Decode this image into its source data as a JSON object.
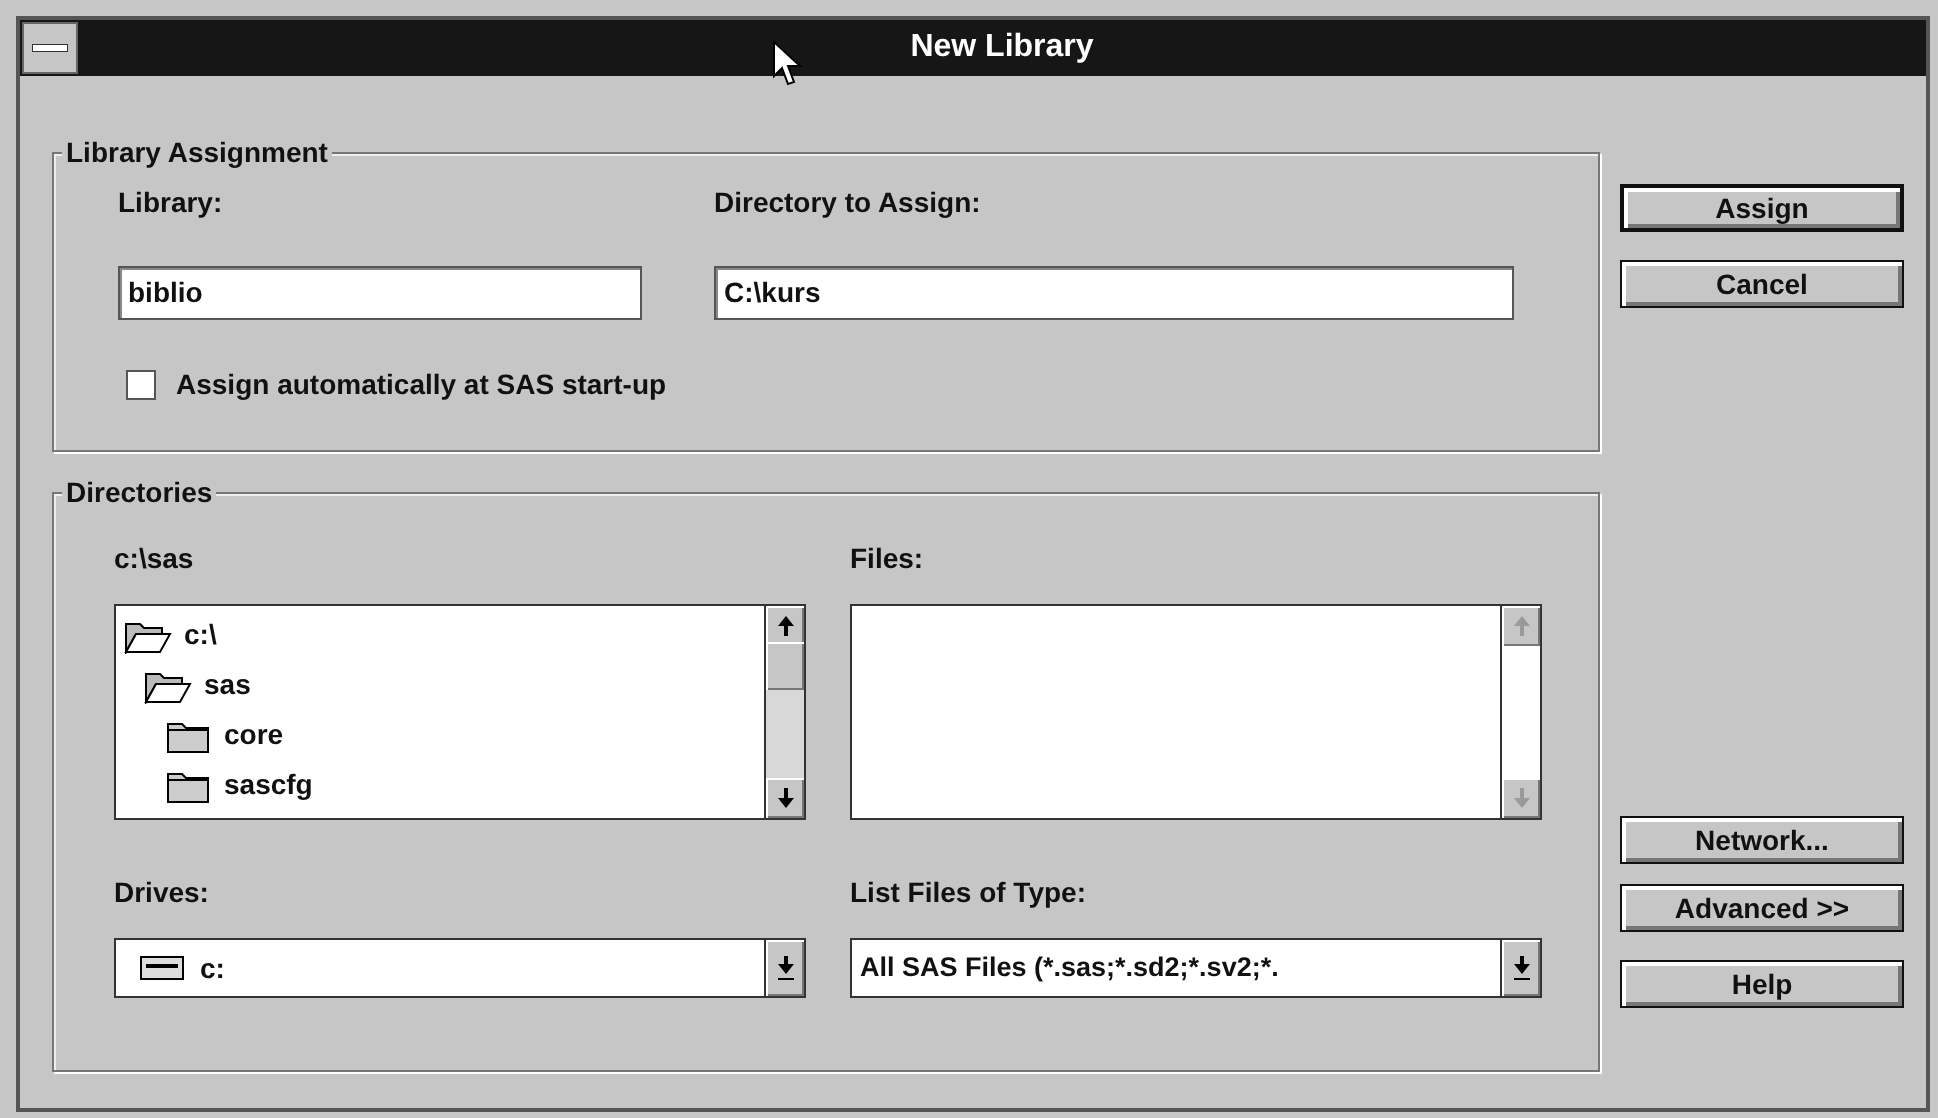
{
  "window": {
    "title": "New Library"
  },
  "library_assignment": {
    "title": "Library Assignment",
    "library_label": "Library:",
    "library_value": "biblio",
    "directory_label": "Directory to Assign:",
    "directory_value": "C:\\kurs",
    "auto_assign": {
      "label": "Assign automatically at SAS start-up",
      "checked": false
    }
  },
  "directories": {
    "title": "Directories",
    "current_path": "c:\\sas",
    "tree": [
      {
        "name": "c:\\",
        "expanded": true,
        "children": [
          {
            "name": "sas",
            "expanded": true,
            "children": [
              {
                "name": "core",
                "expanded": false
              },
              {
                "name": "sascfg",
                "expanded": false
              }
            ]
          }
        ]
      }
    ],
    "files_label": "Files:",
    "drives_label": "Drives:",
    "drive_value": "c:",
    "type_label": "List Files of Type:",
    "type_value": "All SAS Files (*.sas;*.sd2;*.sv2;*."
  },
  "button_groups": [
    [
      {
        "label": "Assign",
        "default": true
      },
      {
        "label": "Cancel",
        "default": false
      }
    ],
    [
      {
        "label": "Network...",
        "default": false
      }
    ],
    [
      {
        "label": "Advanced >>",
        "default": false
      },
      {
        "label": "Help",
        "default": false
      }
    ]
  ]
}
